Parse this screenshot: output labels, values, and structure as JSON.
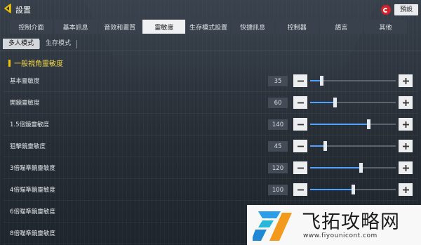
{
  "header": {
    "title": "設置",
    "preset_label": "預設"
  },
  "tabs": [
    {
      "label": "控制介面",
      "active": false
    },
    {
      "label": "基本訊息",
      "active": false
    },
    {
      "label": "音效和畫質",
      "active": false
    },
    {
      "label": "靈敏度",
      "active": true
    },
    {
      "label": "生存模式設置",
      "active": false
    },
    {
      "label": "快捷訊息",
      "active": false
    },
    {
      "label": "控制器",
      "active": false
    },
    {
      "label": "語言",
      "active": false
    },
    {
      "label": "其他",
      "active": false
    }
  ],
  "subtabs": [
    {
      "label": "多人模式",
      "active": true
    },
    {
      "label": "生存模式",
      "active": false
    }
  ],
  "section": {
    "title": "一般視角靈敏度"
  },
  "settings": [
    {
      "label": "基本靈敏度",
      "value": "35",
      "fraction": 0.13
    },
    {
      "label": "開鏡靈敏度",
      "value": "60",
      "fraction": 0.29
    },
    {
      "label": "1.5倍鏡靈敏度",
      "value": "140",
      "fraction": 0.68
    },
    {
      "label": "狙擊鏡靈敏度",
      "value": "45",
      "fraction": 0.17
    },
    {
      "label": "3倍瞄準鏡靈敏度",
      "value": "120",
      "fraction": 0.59
    },
    {
      "label": "4倍瞄準鏡靈敏度",
      "value": "100",
      "fraction": 0.5
    },
    {
      "label": "6倍瞄準鏡靈敏度",
      "value": "",
      "fraction": null
    },
    {
      "label": "8倍瞄準鏡靈敏度",
      "value": "",
      "fraction": null
    }
  ],
  "watermark": {
    "text": "飞拓攻略网",
    "url": "www.fiyounicont.com"
  },
  "colors": {
    "accent_blue": "#4fa3ff",
    "section_yellow": "#f2d64a",
    "brand_red": "#d8202a"
  },
  "icons": {
    "back": "back-arrow-icon",
    "brand": "garena-icon",
    "minus": "minus-icon",
    "plus": "plus-icon"
  }
}
